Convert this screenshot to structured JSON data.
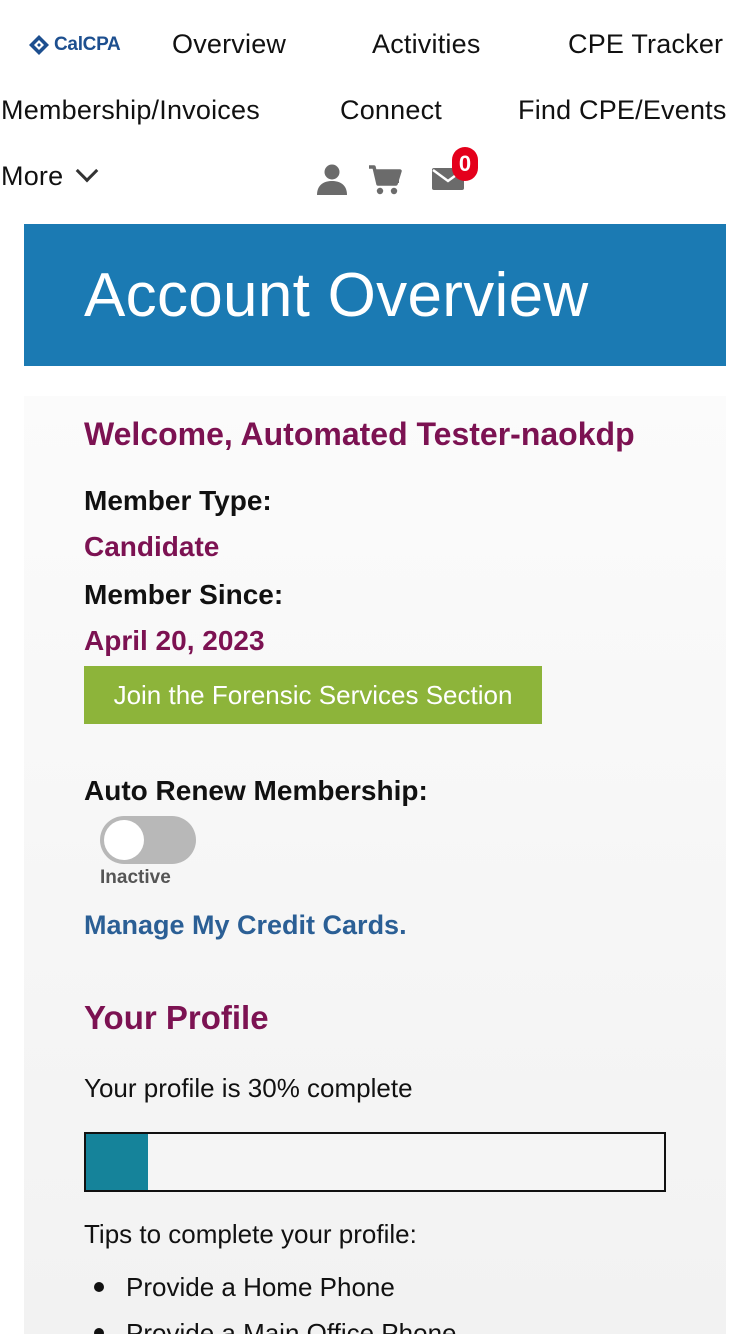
{
  "brand": {
    "name": "CalCPA",
    "color": "#1d4f8f"
  },
  "nav": {
    "items_row1": [
      "Overview",
      "Activities",
      "CPE Tracker"
    ],
    "items_row2": [
      "Membership/Invoices",
      "Connect",
      "Find CPE/Events"
    ],
    "more_label": "More",
    "icons": [
      "user-icon",
      "cart-icon",
      "mail-icon"
    ],
    "mail_count": "0"
  },
  "hero": {
    "title": "Account Overview",
    "color": "#1b7ab3"
  },
  "account": {
    "welcome": "Welcome, Automated Tester-naokdp",
    "member_type_label": "Member Type:",
    "member_type": "Candidate",
    "member_since_label": "Member Since:",
    "member_since": "April 20, 2023",
    "join_button": "Join the Forensic Services Section",
    "auto_renew_label": "Auto Renew Membership:",
    "auto_renew_status": "Inactive",
    "auto_renew_on": false,
    "manage_cards": "Manage My Credit Cards."
  },
  "profile": {
    "title": "Your Profile",
    "completion_text": "Your profile is 30% complete",
    "completion": 0.3,
    "tips_label": "Tips to complete your profile:",
    "tips": [
      "Provide a Home Phone",
      "Provide a Main Office Phone"
    ]
  },
  "colors": {
    "accent_purple": "#7c1252",
    "button_green": "#8db43a",
    "link_blue": "#2b5f95",
    "progress": "#15839a"
  }
}
